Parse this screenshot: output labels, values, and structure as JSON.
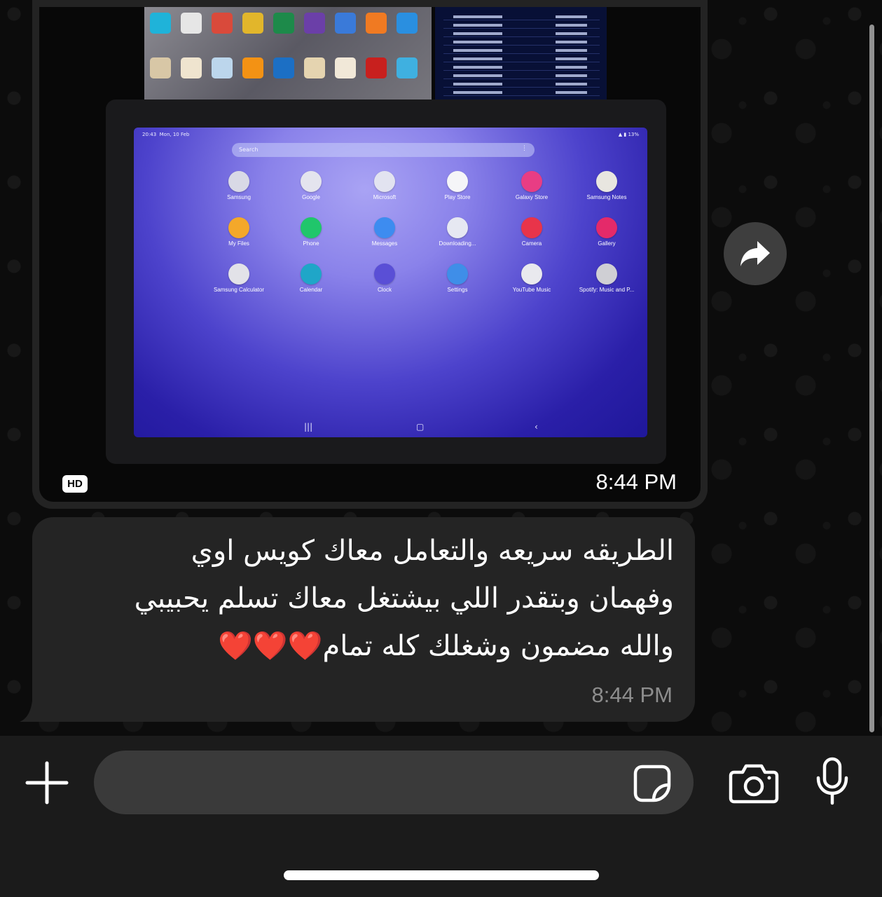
{
  "messages": [
    {
      "type": "image",
      "badge": "HD",
      "time": "8:44 PM",
      "photo": {
        "tablet": {
          "status_time": "20:43",
          "status_date": "Mon, 10 Feb",
          "battery": "13%",
          "search_placeholder": "Search",
          "apps": [
            {
              "label": "Samsung",
              "icon": "samsung-folder-icon",
              "color": "#d9d9e6"
            },
            {
              "label": "Google",
              "icon": "google-folder-icon",
              "color": "#e4e4ee"
            },
            {
              "label": "Microsoft",
              "icon": "microsoft-folder-icon",
              "color": "#e2e3f0"
            },
            {
              "label": "Play Store",
              "icon": "play-store-icon",
              "color": "#f5f5f8"
            },
            {
              "label": "Galaxy Store",
              "icon": "galaxy-store-icon",
              "color": "#e83d84"
            },
            {
              "label": "Samsung Notes",
              "icon": "samsung-notes-icon",
              "color": "#e8e6e0"
            },
            {
              "label": "My Files",
              "icon": "my-files-icon",
              "color": "#f4a82a"
            },
            {
              "label": "Phone",
              "icon": "phone-icon",
              "color": "#20c66b"
            },
            {
              "label": "Messages",
              "icon": "messages-icon",
              "color": "#3d8cf0"
            },
            {
              "label": "Downloading...",
              "icon": "downloading-icon",
              "color": "#e6e8f2"
            },
            {
              "label": "Camera",
              "icon": "camera-app-icon",
              "color": "#e8344a"
            },
            {
              "label": "Gallery",
              "icon": "gallery-icon",
              "color": "#e42a6a"
            },
            {
              "label": "Samsung Calculator",
              "icon": "calculator-icon",
              "color": "#e2e2e8"
            },
            {
              "label": "Calendar",
              "icon": "calendar-icon",
              "color": "#1fa6c8"
            },
            {
              "label": "Clock",
              "icon": "clock-icon",
              "color": "#5a4fd6"
            },
            {
              "label": "Settings",
              "icon": "settings-icon",
              "color": "#3f8ee8"
            },
            {
              "label": "YouTube Music",
              "icon": "youtube-music-icon",
              "color": "#e9e9ee"
            },
            {
              "label": "Spotify: Music and P...",
              "icon": "spotify-icon",
              "color": "#cfcfd4"
            }
          ]
        }
      }
    },
    {
      "type": "text",
      "lines": [
        "الطريقه سريعه والتعامل معاك كويس اوي",
        "وفهمان وبتقدر اللي بيشتغل معاك تسلم يحبيبي",
        "والله مضمون وشغلك كله تمام❤️❤️❤️"
      ],
      "time": "8:44 PM"
    }
  ],
  "input": {
    "placeholder": "",
    "value": ""
  },
  "icons": {
    "plus": "plus-icon",
    "sticker": "sticker-icon",
    "camera": "camera-icon",
    "mic": "microphone-icon",
    "forward": "forward-arrow-icon"
  }
}
